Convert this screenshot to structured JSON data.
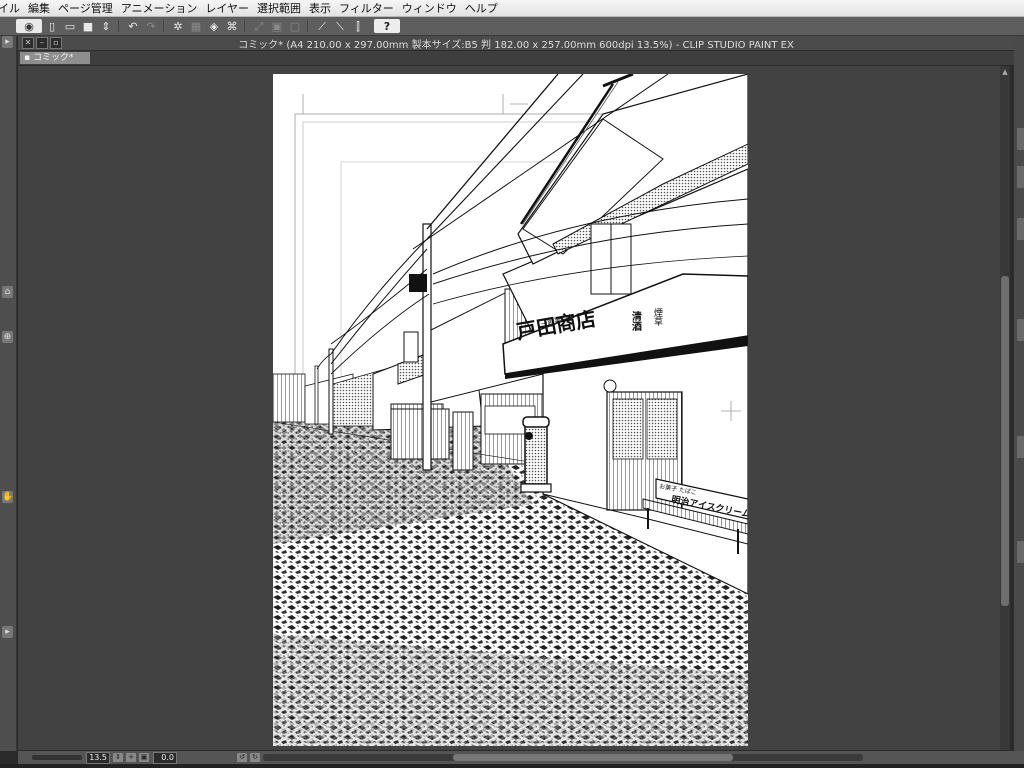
{
  "menu": [
    "イル",
    "編集",
    "ページ管理",
    "アニメーション",
    "レイヤー",
    "選択範囲",
    "表示",
    "フィルター",
    "ウィンドウ",
    "ヘルプ"
  ],
  "toolbar": {
    "icons": [
      "app-logo-icon",
      "new-file-icon",
      "open-file-icon",
      "save-icon",
      "save-options-icon",
      "undo-icon",
      "redo-icon",
      "clear-icon",
      "fill-icon",
      "transform-icon",
      "scale-icon",
      "snap-ruler-icon",
      "snap-grid-icon",
      "snap-special-icon",
      "snap-point-icon",
      "snap-line-icon",
      "snap-perspective-icon",
      "help-icon"
    ]
  },
  "document": {
    "title": "コミック* (A4 210.00 x 297.00mm 製本サイズ:B5 判 182.00 x 257.00mm 600dpi 13.5%)  - CLIP STUDIO PAINT EX",
    "tab_label": "コミック*"
  },
  "status": {
    "zoom": "13.5",
    "rotation": "0.0"
  },
  "artwork": {
    "shop_sign": "戸田商店",
    "shop_sign_small": "—創業百年—",
    "side_sign_1": "清酒",
    "side_sign_2": "煙草",
    "bench_sign_top": "お菓子 たばこ",
    "bench_sign": "明治アイスクリーム"
  },
  "colors": {
    "menubar": "#e6e6e6",
    "toolbar": "#5e5e5e",
    "canvas_bg": "#424242",
    "page": "#ffffff",
    "ink": "#111111"
  }
}
